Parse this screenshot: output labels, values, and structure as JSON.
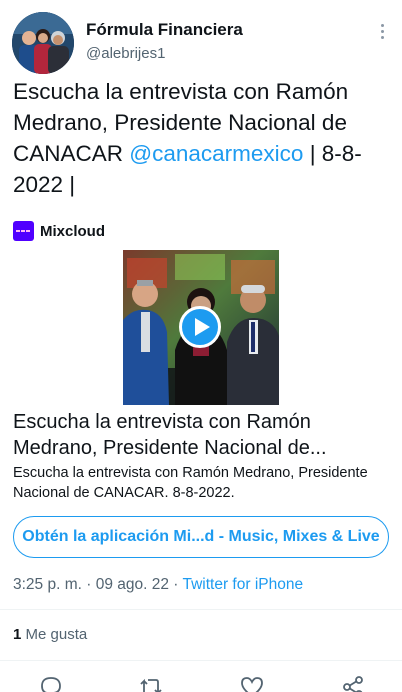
{
  "author": {
    "display_name": "Fórmula Financiera",
    "handle": "@alebrijes1"
  },
  "tweet": {
    "text_before": "Escucha la entrevista con Ramón Medrano, Presidente Nacional de CANACAR ",
    "mention": "@canacarmexico",
    "text_after": " | 8-8-2022 |"
  },
  "card": {
    "source_name": "Mixcloud",
    "title": "Escucha la entrevista con Ramón Medrano, Presidente Nacional de...",
    "description": "Escucha la entrevista con Ramón Medrano, Presidente Nacional de CANACAR. 8-8-2022.",
    "cta_label": "Obtén la aplicación Mi...d - Music, Mixes & Live"
  },
  "meta": {
    "time": "3:25 p. m.",
    "separator": " · ",
    "date": "09 ago. 22",
    "client": "Twitter for iPhone"
  },
  "engagement": {
    "likes_count": "1",
    "likes_label": " Me gusta"
  },
  "icons": {
    "more": "more-vertical-icon",
    "play": "play-icon",
    "reply": "reply-icon",
    "retweet": "retweet-icon",
    "like": "heart-icon",
    "share": "share-icon"
  },
  "colors": {
    "accent": "#1d9bf0",
    "text": "#0f1419",
    "secondary": "#536471",
    "mixcloud": "#5000ff"
  }
}
